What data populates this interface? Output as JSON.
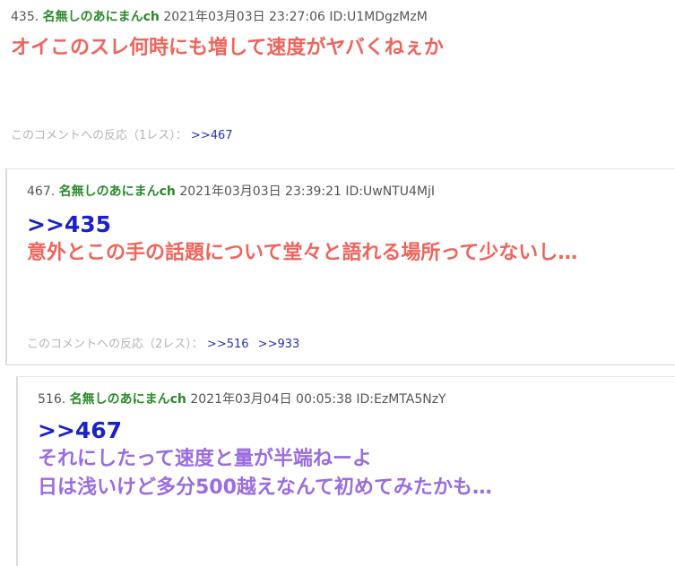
{
  "comments": [
    {
      "number": "435.",
      "name": "名無しのあにまんch",
      "date": "2021年03月03日 23:27:06",
      "id": "ID:U1MDgzMzM",
      "lines": [
        "オイこのスレ何時にも増して速度がヤバくねぇか"
      ],
      "reply_label": "このコメントへの反応（1レス）：",
      "reply_links": [
        ">>467"
      ]
    },
    {
      "number": "467.",
      "name": "名無しのあにまんch",
      "date": "2021年03月03日 23:39:21",
      "id": "ID:UwNTU4MjI",
      "anchor": ">>435",
      "lines": [
        "意外とこの手の話題について堂々と語れる場所って少ないし…"
      ],
      "reply_label": "このコメントへの反応（2レス）：",
      "reply_links": [
        ">>516",
        ">>933"
      ]
    },
    {
      "number": "516.",
      "name": "名無しのあにまんch",
      "date": "2021年03月04日 00:05:38",
      "id": "ID:EzMTA5NzY",
      "anchor": ">>467",
      "lines": [
        "それにしたって速度と量が半端ねーよ",
        "日は浅いけど多分500越えなんて初めてみたかも…"
      ]
    }
  ],
  "colors": {
    "name": "#2a8a2a",
    "anchor": "#1a22c8",
    "body_red": "#f0645c",
    "body_purple": "#9b6ce0",
    "reply_link": "#2433b8",
    "reply_label": "#b4b4b4"
  }
}
